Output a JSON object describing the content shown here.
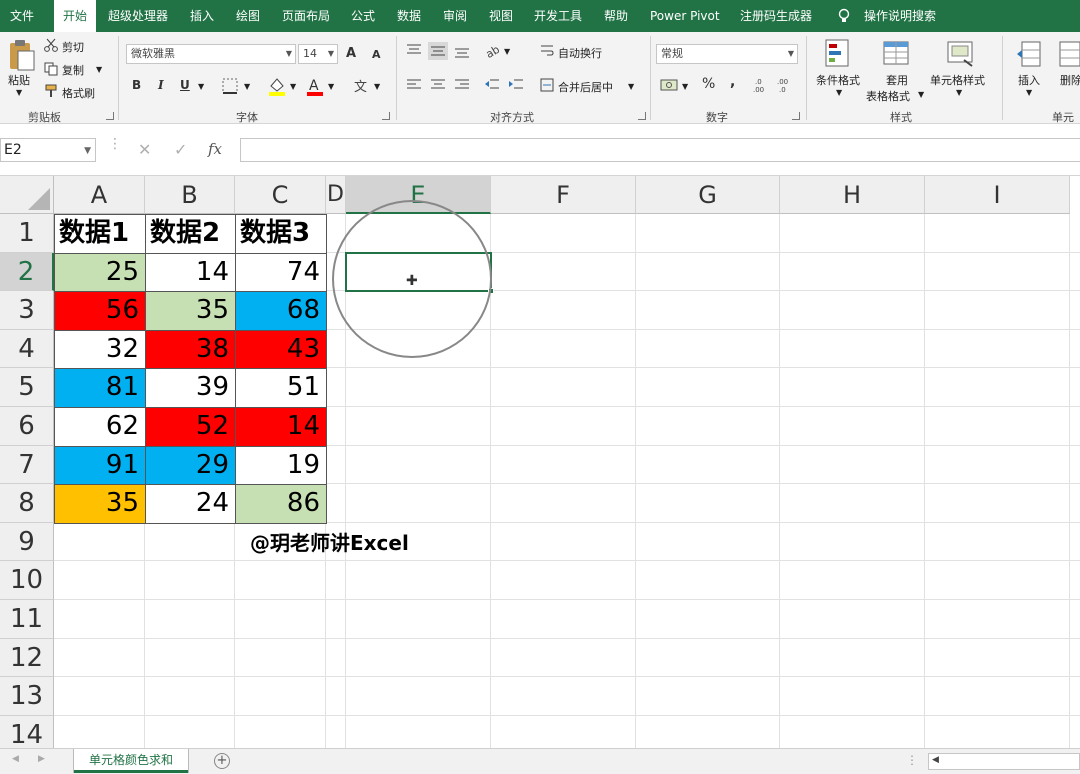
{
  "menu": {
    "tabs": [
      "文件",
      "开始",
      "超级处理器",
      "插入",
      "绘图",
      "页面布局",
      "公式",
      "数据",
      "审阅",
      "视图",
      "开发工具",
      "帮助",
      "Power Pivot",
      "注册码生成器"
    ],
    "active_tab": "开始",
    "search_label": "操作说明搜索"
  },
  "ribbon": {
    "clipboard": {
      "paste": "粘贴",
      "cut": "剪切",
      "copy": "复制",
      "format_painter": "格式刷",
      "label": "剪贴板"
    },
    "font": {
      "name": "微软雅黑",
      "size": "14",
      "bold": "B",
      "italic": "I",
      "underline": "U",
      "label": "字体",
      "grow": "A",
      "shrink": "A"
    },
    "alignment": {
      "wrap": "自动换行",
      "merge": "合并后居中",
      "label": "对齐方式"
    },
    "number": {
      "format": "常规",
      "percent": "%",
      "comma": ",",
      "label": "数字"
    },
    "styles": {
      "conditional": "条件格式",
      "table_line1": "套用",
      "table_line2": "表格格式",
      "cell_styles": "单元格样式",
      "label": "样式"
    },
    "cells": {
      "insert": "插入",
      "delete": "删除",
      "label": "单元"
    }
  },
  "formula_bar": {
    "name_box": "E2",
    "fx": "fx",
    "formula": ""
  },
  "columns": [
    "A",
    "B",
    "C",
    "D",
    "E",
    "F",
    "G",
    "H",
    "I"
  ],
  "rows": [
    "1",
    "2",
    "3",
    "4",
    "5",
    "6",
    "7",
    "8",
    "9",
    "10",
    "11",
    "12",
    "13",
    "14"
  ],
  "table": {
    "headers": [
      "数据1",
      "数据2",
      "数据3"
    ],
    "rows": [
      [
        "25",
        "14",
        "74"
      ],
      [
        "56",
        "35",
        "68"
      ],
      [
        "32",
        "38",
        "43"
      ],
      [
        "81",
        "39",
        "51"
      ],
      [
        "62",
        "52",
        "14"
      ],
      [
        "91",
        "29",
        "19"
      ],
      [
        "35",
        "24",
        "86"
      ]
    ],
    "fill_colors": [
      [
        "#c6e0b4",
        "#ffffff",
        "#ffffff"
      ],
      [
        "#ff0000",
        "#c6e0b4",
        "#00b0f0"
      ],
      [
        "#ffffff",
        "#ff0000",
        "#ff0000"
      ],
      [
        "#00b0f0",
        "#ffffff",
        "#ffffff"
      ],
      [
        "#ffffff",
        "#ff0000",
        "#ff0000"
      ],
      [
        "#00b0f0",
        "#00b0f0",
        "#ffffff"
      ],
      [
        "#ffc000",
        "#ffffff",
        "#c6e0b4"
      ]
    ]
  },
  "watermark": "@玥老师讲Excel",
  "sheet_tab": "单元格颜色求和",
  "accent_color": "#217346"
}
